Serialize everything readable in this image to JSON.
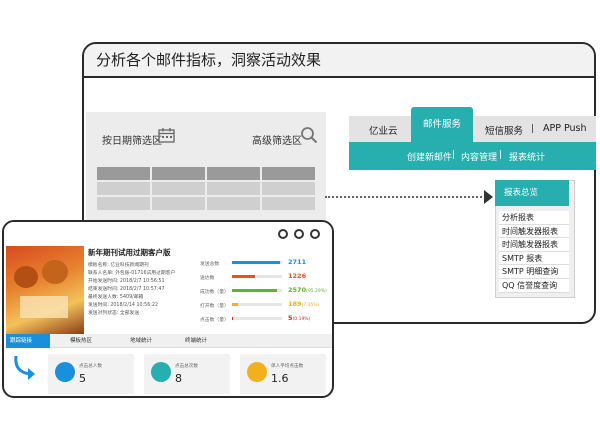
{
  "headline": "分析各个邮件指标，洞察活动效果",
  "filters": {
    "date_label": "按日期筛选区",
    "advanced_label": "高级筛选区"
  },
  "nav": {
    "tabs": [
      {
        "label": "亿业云"
      },
      {
        "label": "邮件服务"
      },
      {
        "label": "短信服务"
      },
      {
        "label": "APP Push"
      }
    ],
    "separator": "|",
    "subnav": [
      {
        "label": "创建新邮件"
      },
      {
        "label": "内容管理"
      },
      {
        "label": "报表统计"
      }
    ]
  },
  "report_menu": {
    "header": "报表总览",
    "items": [
      {
        "label": "分析报表"
      },
      {
        "label": "时间触发器报表"
      },
      {
        "label": "时间触发器报表"
      },
      {
        "label": "SMTP 报表"
      },
      {
        "label": "SMTP 明细查询"
      },
      {
        "label": "QQ 信誉度查询"
      }
    ]
  },
  "campaign": {
    "title": "新年期刊试用过期客户版",
    "meta": [
      "模板名称: 亿业科技新闻期刊",
      "联系人名单: 外包账-01716试用过期客户",
      "开始发送时间: 2018/2/7 10:56:51",
      "结束发送时间: 2018/2/7 10:57:47",
      "最终发送人数: 5409/邮箱",
      "发送时间: 2018/2/14 10:56:22",
      "发送对列状态: 全部发送"
    ],
    "metrics": [
      {
        "label": "发送总数",
        "value": "2711",
        "pct": "",
        "color": "#1a8fdc",
        "fill": 0.95
      },
      {
        "label": "送达数",
        "value": "1226",
        "pct": "",
        "color": "#e8531f",
        "fill": 0.45
      },
      {
        "label": "成功数（量）",
        "value": "2570",
        "pct": "(95.29%)",
        "color": "#5cb531",
        "fill": 0.9
      },
      {
        "label": "打开数（量）",
        "value": "189",
        "pct": "(7.35%)",
        "color": "#f2b01e",
        "fill": 0.12
      },
      {
        "label": "点击数（量）",
        "value": "5",
        "pct": "(0.19%)",
        "color": "#e01f26",
        "fill": 0.02
      }
    ]
  },
  "bottom_tabs": [
    {
      "label": "跟踪链接"
    },
    {
      "label": "模板热区"
    },
    {
      "label": "地域统计"
    },
    {
      "label": "终端统计"
    }
  ],
  "stats": [
    {
      "label": "点击总人数",
      "value": "5",
      "color": "#1a8fdc"
    },
    {
      "label": "点击总次数",
      "value": "8",
      "color": "#27aeae"
    },
    {
      "label": "单人平均点击数",
      "value": "1.6",
      "color": "#f2b01e"
    }
  ]
}
